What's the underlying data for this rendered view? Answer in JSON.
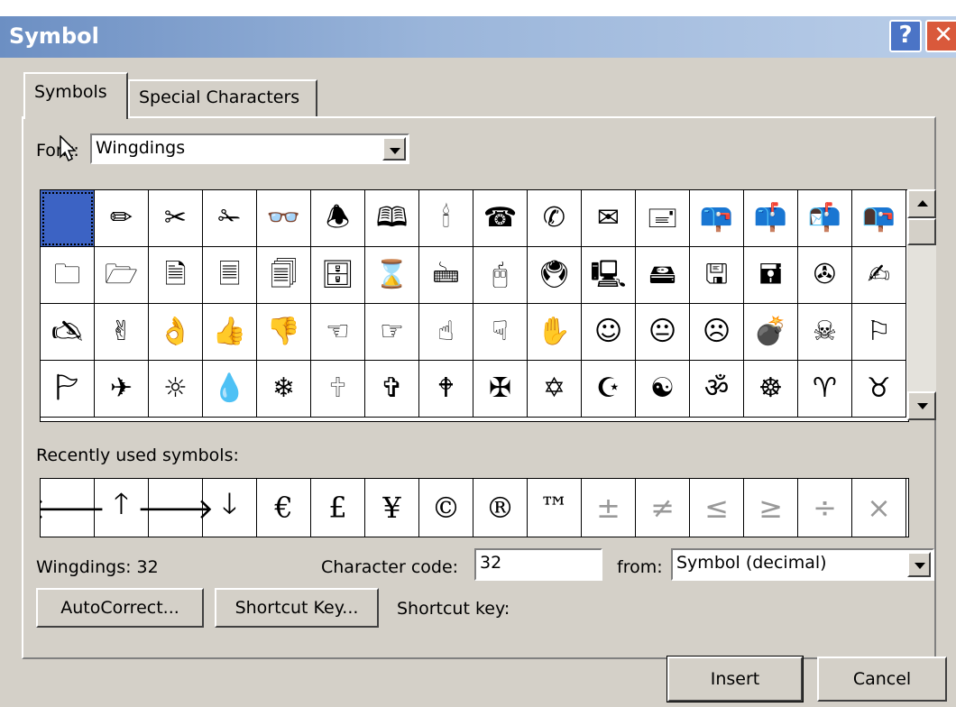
{
  "window": {
    "title": "Symbol",
    "help_glyph": "?",
    "close_glyph": "✕",
    "accent_color": "#3c63c4"
  },
  "tabs": [
    {
      "label": "Symbols",
      "accel": "S",
      "active": true
    },
    {
      "label": "Special Characters",
      "accel": "p",
      "active": false
    }
  ],
  "font": {
    "label": "Font:",
    "value": "Wingdings"
  },
  "symbol_grid": {
    "rows": [
      [
        " ",
        "✏",
        "✂",
        "✁",
        "👓",
        "🕭",
        "🕮",
        "🕯",
        "☎",
        "✆",
        "✉",
        "🖃",
        "📪",
        "📫",
        "📬",
        "📭"
      ],
      [
        "🗀",
        "🗁",
        "🗎",
        "🗏",
        "🗐",
        "🗄",
        "⌛",
        "🖮",
        "🖰",
        "🖲",
        "🖳",
        "🖴",
        "🖫",
        "🖬",
        "✇",
        "✍"
      ],
      [
        "🖎",
        "✌",
        "👌",
        "👍",
        "👎",
        "☜",
        "☞",
        "☝",
        "☟",
        "✋",
        "☺",
        "😐",
        "☹",
        "💣",
        "☠",
        "⚐"
      ],
      [
        "🏱",
        "✈",
        "☼",
        "💧",
        "❄",
        "🕆",
        "✞",
        "🕈",
        "✠",
        "✡",
        "☪",
        "☯",
        "ॐ",
        "☸",
        "♈",
        "♉"
      ]
    ],
    "selected_index": 0
  },
  "recent": {
    "label": "Recently used symbols:",
    "symbols": [
      "🡐",
      "🡑",
      "🡒",
      "🡓",
      "€",
      "£",
      "¥",
      "©",
      "®",
      "™",
      "±",
      "≠",
      "≤",
      "≥",
      "÷",
      "×"
    ],
    "dim_from_index": 10
  },
  "info": {
    "char_name": "Wingdings: 32",
    "char_code_label": "Character code:",
    "char_code_value": "32",
    "from_label": "from:",
    "from_value": "Symbol (decimal)"
  },
  "buttons": {
    "autocorrect": "AutoCorrect...",
    "shortcut_key": "Shortcut Key...",
    "shortcut_key_label": "Shortcut key:",
    "insert": "Insert",
    "cancel": "Cancel"
  }
}
